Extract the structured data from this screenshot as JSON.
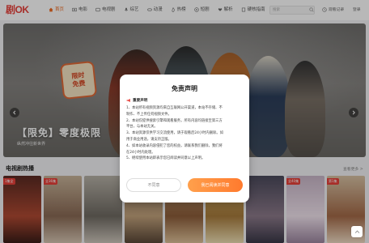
{
  "header": {
    "logo": "剧OK",
    "nav": [
      {
        "label": "首页",
        "icon": "home-icon",
        "active": true
      },
      {
        "label": "电影",
        "icon": "film-icon",
        "active": false
      },
      {
        "label": "电视剧",
        "icon": "tv-icon",
        "active": false
      },
      {
        "label": "综艺",
        "icon": "mic-icon",
        "active": false
      },
      {
        "label": "动漫",
        "icon": "gamepad-icon",
        "active": false
      },
      {
        "label": "热榜",
        "icon": "fire-icon",
        "active": false
      },
      {
        "label": "短剧",
        "icon": "play-icon",
        "active": false
      },
      {
        "label": "解析",
        "icon": "heart-icon",
        "active": false
      },
      {
        "label": "硬核指南",
        "icon": "book-icon",
        "active": false
      }
    ],
    "search_placeholder": "搜索",
    "history_label": "观看记录",
    "login_label": "登录"
  },
  "banner": {
    "badge_line1": "限时",
    "badge_line2": "免费",
    "title": "【限免】零度极限",
    "subtitle": "纵然冲往新世界"
  },
  "section": {
    "title": "电视剧热播",
    "more_label": "查看更多 >",
    "cards": [
      {
        "tag": "1集全"
      },
      {
        "tag": "全36集"
      },
      {
        "tag": ""
      },
      {
        "tag": ""
      },
      {
        "tag": ""
      },
      {
        "tag": ""
      },
      {
        "tag": ""
      },
      {
        "tag": "全40集"
      },
      {
        "tag": "第1集"
      }
    ]
  },
  "modal": {
    "title": "免责声明",
    "notice_label": "重要声明",
    "lines": [
      "1、本站所有视频资源均来自互联网公开渠道，本站不存储、不",
      "制作、不上传任何视频文件。",
      "2、本站仅提供搜索引擎和观看服务，所有内容均链接至第三方",
      "平台，与本站无关。",
      "3、本站资源仅供学习交流使用，请于观看后24小时内删除。如",
      "用于商业用途，请支持正版。",
      "4、如本站收录内容侵犯了您的权益，请联系我们删除，我们将",
      "在24小时内处理。",
      "5、继续使用本站即表示您已阅读并同意以上声明。"
    ],
    "decline_label": "不同意",
    "accept_label": "我已阅读并同意"
  }
}
